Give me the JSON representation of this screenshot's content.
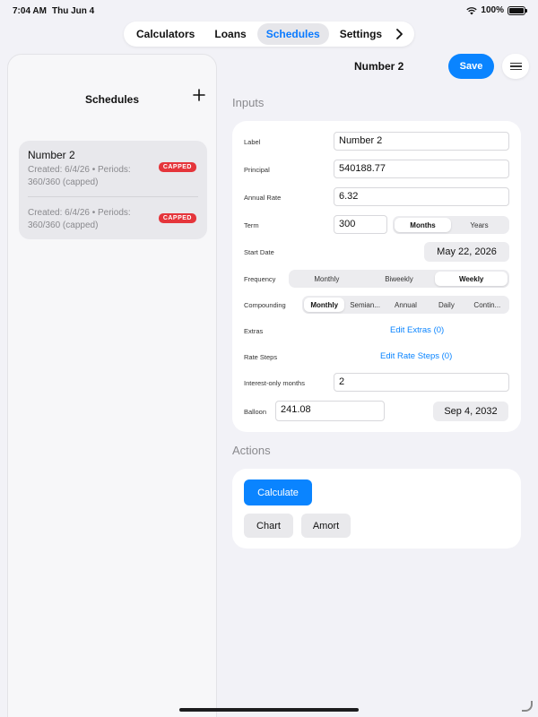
{
  "status": {
    "time": "7:04 AM",
    "date": "Thu Jun 4",
    "battery": "100%",
    "battery_level": 1.0
  },
  "top_nav": {
    "tabs": [
      {
        "label": "Calculators",
        "active": false
      },
      {
        "label": "Loans",
        "active": false
      },
      {
        "label": "Schedules",
        "active": true
      },
      {
        "label": "Settings",
        "active": false
      }
    ],
    "more_icon": "chevron-right-icon"
  },
  "sidebar": {
    "title": "Schedules",
    "add_icon": "plus-icon",
    "items": [
      {
        "name": "Number 2",
        "meta": "Created: 6/4/26 • Periods: 360/360 (capped)",
        "badge": "CAPPED"
      },
      {
        "name": "",
        "meta": "Created: 6/4/26 • Periods: 360/360 (capped)",
        "badge": "CAPPED"
      }
    ]
  },
  "detail": {
    "title": "Number 2",
    "save_label": "Save",
    "menu_icon": "hamburger-menu-icon"
  },
  "inputs": {
    "section_title": "Inputs",
    "label": {
      "label": "Label",
      "value": "Number 2"
    },
    "principal": {
      "label": "Principal",
      "value": "540188.77"
    },
    "annual_rate": {
      "label": "Annual Rate",
      "value": "6.32"
    },
    "term": {
      "label": "Term",
      "value": "300",
      "units": [
        "Months",
        "Years"
      ],
      "selected": "Months"
    },
    "start_date": {
      "label": "Start Date",
      "value": "May 22, 2026"
    },
    "frequency": {
      "label": "Frequency",
      "options": [
        "Monthly",
        "Biweekly",
        "Weekly"
      ],
      "selected": "Weekly"
    },
    "compounding": {
      "label": "Compounding",
      "options": [
        "Monthly",
        "Semian...",
        "Annual",
        "Daily",
        "Contin..."
      ],
      "selected": "Monthly"
    },
    "extras": {
      "label": "Extras",
      "link": "Edit Extras (0)"
    },
    "rate_steps": {
      "label": "Rate Steps",
      "link": "Edit Rate Steps (0)"
    },
    "interest_only": {
      "label": "Interest-only months",
      "value": "2"
    },
    "balloon": {
      "label": "Balloon",
      "value": "241.08",
      "date": "Sep 4, 2032"
    }
  },
  "actions": {
    "section_title": "Actions",
    "calculate_label": "Calculate",
    "chart_label": "Chart",
    "amort_label": "Amort"
  },
  "colors": {
    "accent": "#0a84ff",
    "badge": "#e5353b",
    "background": "#f2f2f7"
  }
}
